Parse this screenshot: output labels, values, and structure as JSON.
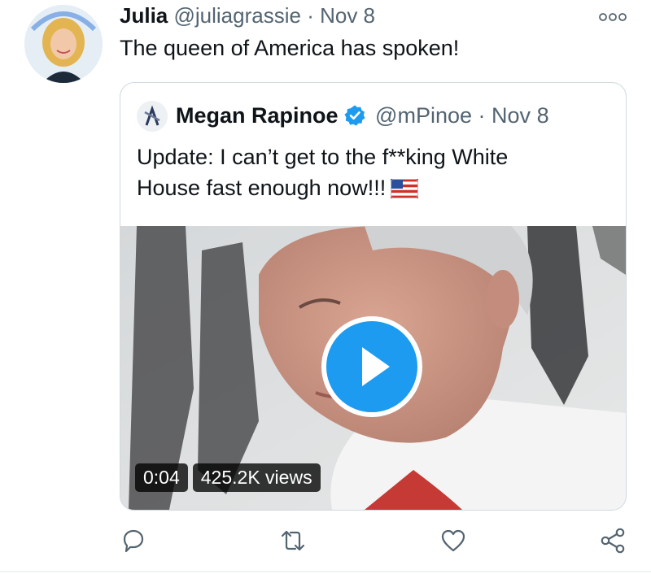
{
  "tweet": {
    "author_name": "Julia",
    "handle": "@juliagrassie",
    "separator": "·",
    "date": "Nov 8",
    "text": "The queen of America has spoken!"
  },
  "quoted_tweet": {
    "author_name": "Megan Rapinoe",
    "verified": true,
    "handle": "@mPinoe",
    "separator": "·",
    "date": "Nov 8",
    "text_lines": [
      "Update: I can’t get to the f**king White",
      "House fast enough now!!!"
    ],
    "emoji": "us-flag"
  },
  "video": {
    "duration": "0:04",
    "views": "425.2K views",
    "play_icon": "play-icon"
  },
  "actions": [
    "reply-icon",
    "retweet-icon",
    "like-icon",
    "share-icon"
  ],
  "menu_icon": "more-options-icon",
  "colors": {
    "accent": "#1d9bf0",
    "text": "#0f1419",
    "secondary": "#536471",
    "border": "#cfd9de"
  }
}
